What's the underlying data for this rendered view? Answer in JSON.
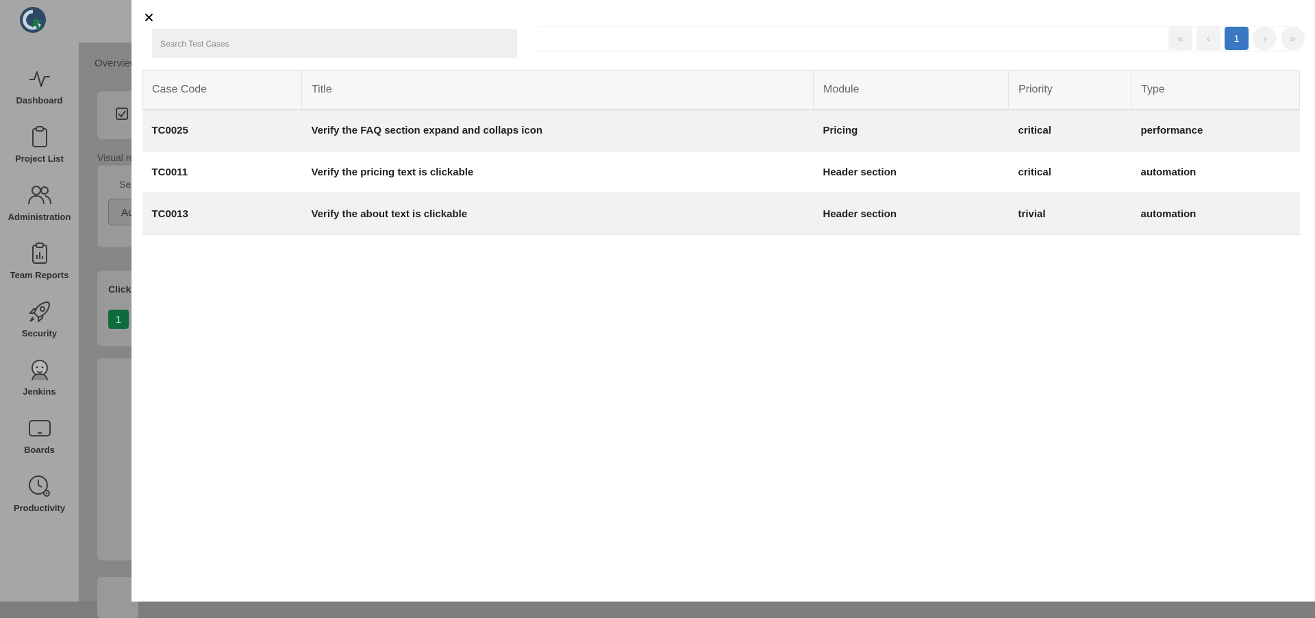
{
  "sidebar": {
    "items": [
      {
        "label": "Dashboard",
        "icon": "activity-icon"
      },
      {
        "label": "Project List",
        "icon": "clipboard-icon"
      },
      {
        "label": "Administration",
        "icon": "users-icon"
      },
      {
        "label": "Team Reports",
        "icon": "clipboard-chart-icon"
      },
      {
        "label": "Security",
        "icon": "rocket-icon"
      },
      {
        "label": "Jenkins",
        "icon": "jenkins-icon"
      },
      {
        "label": "Boards",
        "icon": "tablet-icon"
      },
      {
        "label": "Productivity",
        "icon": "clock-gear-icon"
      }
    ]
  },
  "background": {
    "overview_label": "Overview",
    "visual_label": "Visual re",
    "select_label": "Se",
    "select_value": "Au",
    "click_label": "Click",
    "badge_value": "1"
  },
  "drawer": {
    "search": {
      "placeholder": "Search Test Cases",
      "value": ""
    },
    "pagination": {
      "first": "«",
      "prev": "‹",
      "current": "1",
      "next": "›",
      "last": "»"
    },
    "table": {
      "columns": [
        "Case Code",
        "Title",
        "Module",
        "Priority",
        "Type"
      ],
      "rows": [
        {
          "code": "TC0025",
          "title": "Verify the FAQ section expand and collaps icon",
          "module": "Pricing",
          "priority": "critical",
          "type": "performance"
        },
        {
          "code": "TC0011",
          "title": "Verify the pricing text is clickable",
          "module": "Header section",
          "priority": "critical",
          "type": "automation"
        },
        {
          "code": "TC0013",
          "title": "Verify the about text is clickable",
          "module": "Header section",
          "priority": "trivial",
          "type": "automation"
        }
      ]
    }
  },
  "colors": {
    "accent": "#3a78c3",
    "brand_green": "#1b7a4a",
    "overlay": "#7d7d7d"
  }
}
